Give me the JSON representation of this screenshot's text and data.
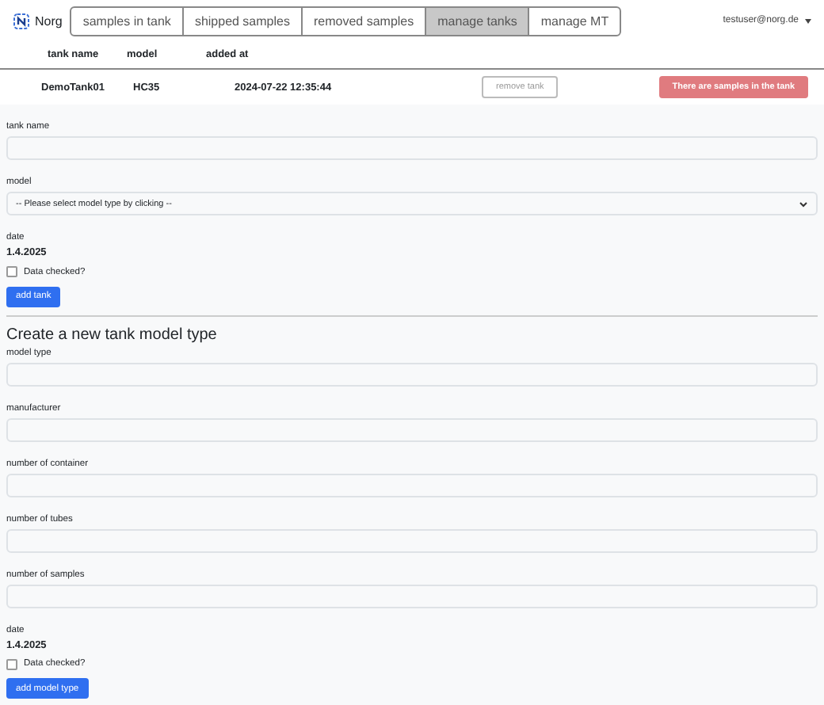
{
  "nav": {
    "brand": "Norg",
    "tabs": [
      {
        "label": "samples in tank",
        "selected": false
      },
      {
        "label": "shipped samples",
        "selected": false
      },
      {
        "label": "removed samples",
        "selected": false
      },
      {
        "label": "manage tanks",
        "selected": true
      },
      {
        "label": "manage MT",
        "selected": false
      }
    ],
    "user": "testuser@norg.de"
  },
  "table": {
    "columns": [
      "tank name",
      "model",
      "added at"
    ],
    "rows": [
      {
        "cells": [
          "DemoTank01",
          "HC35",
          "2024-07-22 12:35:44"
        ],
        "remove_button": {
          "label": "remove tank",
          "disabled": true
        },
        "warning": "There are samples in the tank"
      }
    ]
  },
  "tank_form": {
    "fields": [
      {
        "kind": "text",
        "label": "tank name"
      },
      {
        "kind": "select",
        "label": "model",
        "value": "-- Please select model type by clicking --"
      }
    ],
    "date_label": "date",
    "date": "1.4.2025",
    "check": {
      "label": "Data checked?",
      "checked": false
    },
    "submit": "add tank"
  },
  "model_form": {
    "title": "Create a new tank model type",
    "fields": [
      {
        "kind": "text",
        "label": "model type"
      },
      {
        "kind": "text",
        "label": "manufacturer"
      },
      {
        "kind": "text",
        "label": "number of container"
      },
      {
        "kind": "text",
        "label": "number of tubes"
      },
      {
        "kind": "text",
        "label": "number of samples"
      }
    ],
    "date_label": "date",
    "date": "1.4.2025",
    "check": {
      "label": "Data checked?",
      "checked": false
    },
    "submit": "add model type"
  }
}
